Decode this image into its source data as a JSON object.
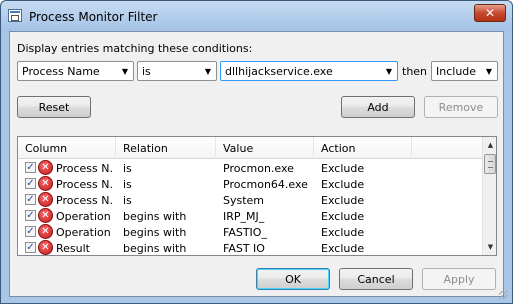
{
  "window": {
    "title": "Process Monitor Filter",
    "close_glyph": "✕",
    "icon": "filter-window-icon"
  },
  "condition": {
    "prompt": "Display entries matching these conditions:",
    "column": "Process Name",
    "relation": "is",
    "value": "dllhijackservice.exe",
    "then_label": "then",
    "action": "Include"
  },
  "buttons": {
    "reset": "Reset",
    "add": "Add",
    "remove": "Remove",
    "ok": "OK",
    "cancel": "Cancel",
    "apply": "Apply"
  },
  "table": {
    "headers": [
      "Column",
      "Relation",
      "Value",
      "Action"
    ],
    "rows": [
      {
        "column": "Process N...",
        "relation": "is",
        "value": "Procmon.exe",
        "action": "Exclude"
      },
      {
        "column": "Process N...",
        "relation": "is",
        "value": "Procmon64.exe",
        "action": "Exclude"
      },
      {
        "column": "Process N...",
        "relation": "is",
        "value": "System",
        "action": "Exclude"
      },
      {
        "column": "Operation",
        "relation": "begins with",
        "value": "IRP_MJ_",
        "action": "Exclude"
      },
      {
        "column": "Operation",
        "relation": "begins with",
        "value": "FASTIO_",
        "action": "Exclude"
      },
      {
        "column": "Result",
        "relation": "begins with",
        "value": "FAST IO",
        "action": "Exclude"
      }
    ],
    "check_glyph": "✓",
    "exclude_glyph": "✕"
  },
  "colors": {
    "exclude_icon": "#c81414",
    "title_bar": "#a9c6e6",
    "focus_border": "#3399ff"
  }
}
